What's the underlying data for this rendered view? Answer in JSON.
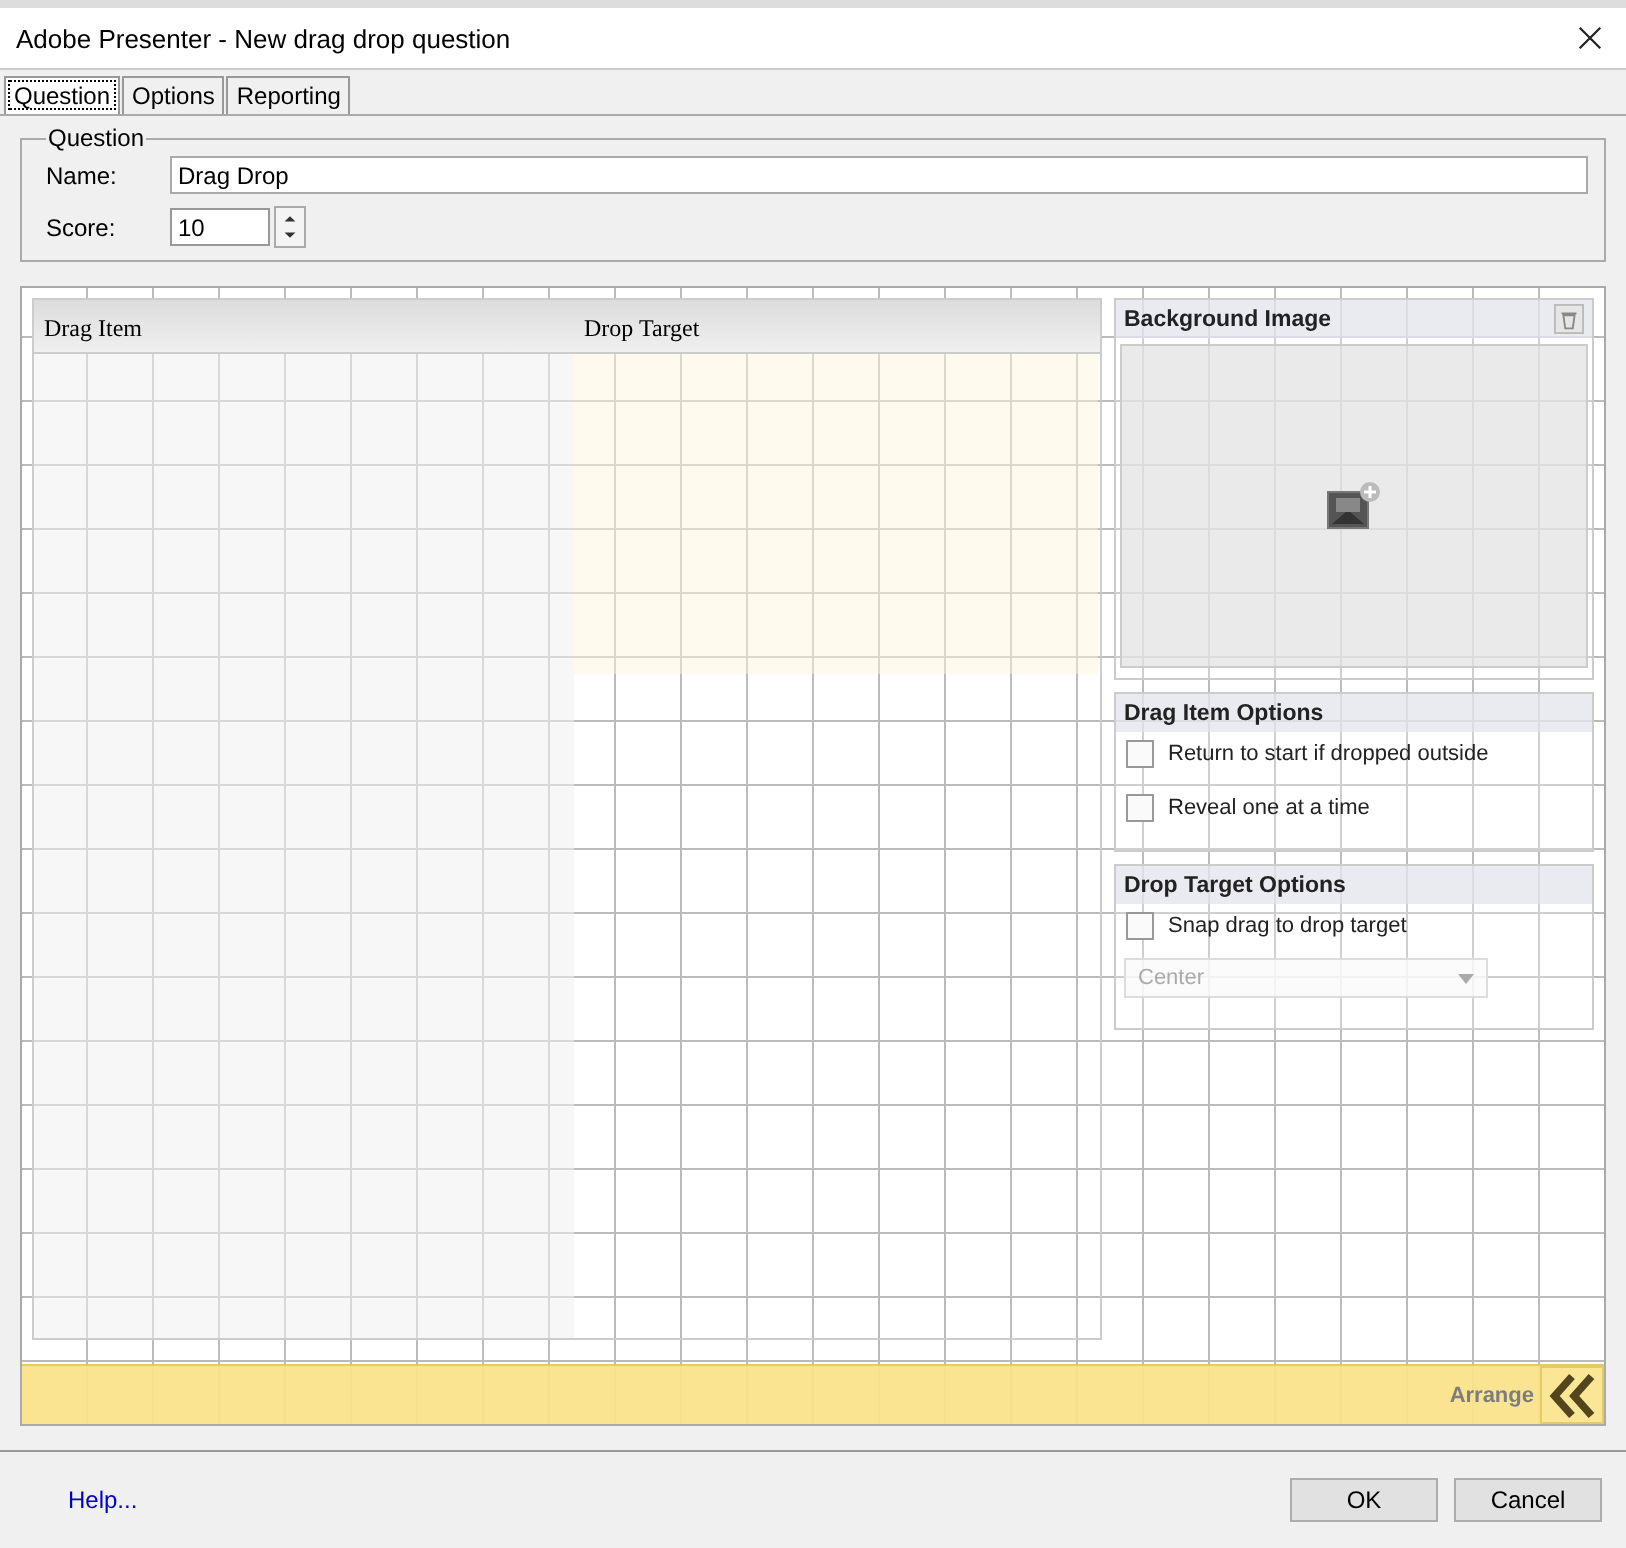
{
  "window": {
    "title": "Adobe Presenter - New drag drop question"
  },
  "tabs": [
    {
      "label": "Question",
      "selected": true
    },
    {
      "label": "Options",
      "selected": false
    },
    {
      "label": "Reporting",
      "selected": false
    }
  ],
  "question_group": {
    "legend": "Question",
    "name_label": "Name:",
    "name_value": "Drag Drop",
    "score_label": "Score:",
    "score_value": "10"
  },
  "table": {
    "columns": [
      "Drag Item",
      "Drop Target"
    ]
  },
  "background_image": {
    "title": "Background Image"
  },
  "drag_item_options": {
    "title": "Drag Item Options",
    "options": [
      {
        "label": "Return to start if dropped outside",
        "checked": false
      },
      {
        "label": "Reveal one at a time",
        "checked": false
      }
    ]
  },
  "drop_target_options": {
    "title": "Drop Target Options",
    "options": [
      {
        "label": "Snap drag to drop target",
        "checked": false
      }
    ],
    "position": {
      "value": "Center",
      "disabled": true
    }
  },
  "arrange_bar": {
    "label": "Arrange"
  },
  "footer": {
    "help": "Help...",
    "buttons": [
      "OK",
      "Cancel"
    ]
  }
}
